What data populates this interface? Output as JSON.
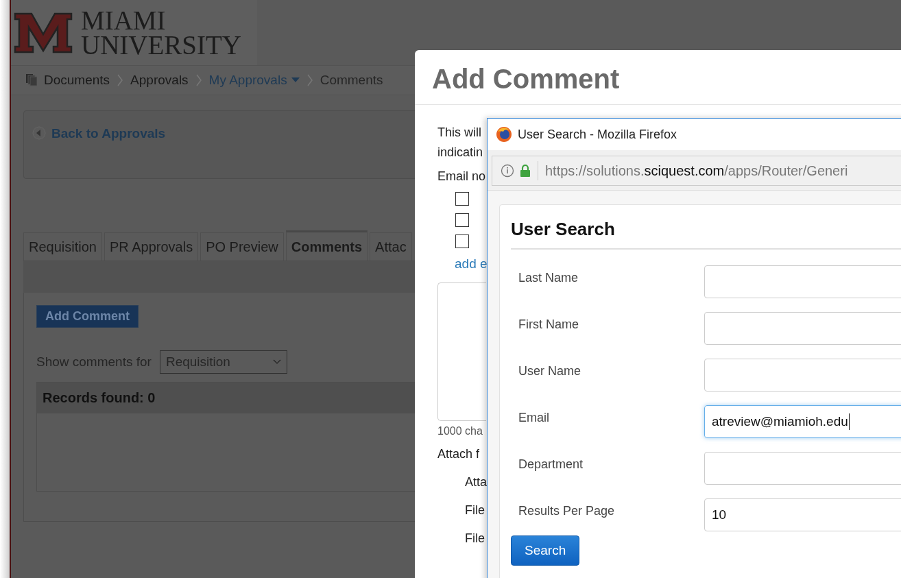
{
  "logo": {
    "line1": "MIAMI",
    "line2": "UNIVERSITY"
  },
  "breadcrumb": [
    {
      "label": "Documents",
      "kind": "root"
    },
    {
      "label": "Approvals",
      "kind": "plain"
    },
    {
      "label": "My Approvals",
      "kind": "menu"
    },
    {
      "label": "Comments",
      "kind": "current"
    }
  ],
  "back_link": "Back to Approvals",
  "tabs": [
    {
      "label": "Requisition",
      "selected": false
    },
    {
      "label": "PR Approvals",
      "selected": false
    },
    {
      "label": "PO Preview",
      "selected": false
    },
    {
      "label": "Comments",
      "selected": true
    },
    {
      "label": "Attac",
      "selected": false
    }
  ],
  "add_comment_button": "Add Comment",
  "filter": {
    "label": "Show comments for",
    "value": "Requisition"
  },
  "records": "Records found: 0",
  "modal": {
    "title": "Add Comment",
    "intro": [
      "This will",
      "indicatin"
    ],
    "email_label": "Email no",
    "checkboxes": [
      {
        "checked": false
      },
      {
        "checked": false
      },
      {
        "checked": false
      }
    ],
    "add_link": "add e",
    "char_count": "1000 cha",
    "attach_label": "Attach f",
    "attach_rows": [
      "Atta",
      "File",
      "File"
    ]
  },
  "popup": {
    "title": "User Search - Mozilla Firefox",
    "url": {
      "scheme": "https://solutions.",
      "domain": "sciquest.com",
      "path": "/apps/Router/Generi"
    },
    "heading": "User Search",
    "fields": [
      {
        "label": "Last Name",
        "focused": false
      },
      {
        "label": "First Name",
        "focused": false
      },
      {
        "label": "User Name",
        "focused": false
      },
      {
        "label": "Email",
        "value": "atreview@miamioh.edu",
        "focused": true
      },
      {
        "label": "Department",
        "focused": false
      },
      {
        "label": "Results Per Page",
        "value": "10",
        "focused": false
      }
    ],
    "button": "Search"
  }
}
